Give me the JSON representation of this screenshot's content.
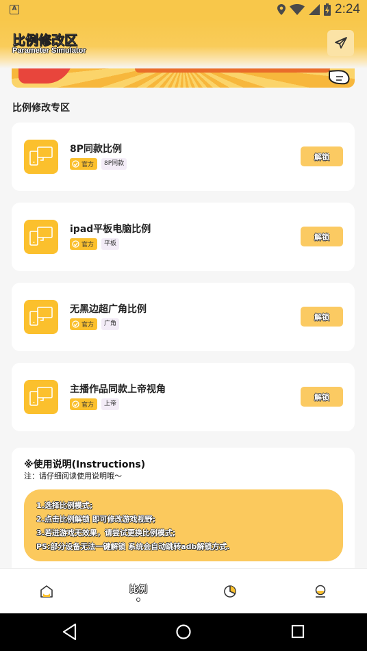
{
  "status_bar": {
    "time": "2:24",
    "app_badge": "A"
  },
  "header": {
    "title": "比例修改区",
    "subtitle": "Parameter Simulator",
    "send_icon": "send-icon"
  },
  "section_title": "比例修改专区",
  "cards": [
    {
      "name": "8P同款比例",
      "tag_official": "官方",
      "tag_category": "8P同款",
      "button": "解锁"
    },
    {
      "name": "ipad平板电脑比例",
      "tag_official": "官方",
      "tag_category": "平板",
      "button": "解锁"
    },
    {
      "name": "无黑边超广角比例",
      "tag_official": "官方",
      "tag_category": "广角",
      "button": "解锁"
    },
    {
      "name": "主播作品同款上帝视角",
      "tag_official": "官方",
      "tag_category": "上帝",
      "button": "解锁"
    }
  ],
  "instructions": {
    "heading": "※使用说明(Instructions)",
    "note": "注：请仔细阅读使用说明哦～",
    "lines": [
      "1.选择比例模式;",
      "2.点击比例解锁 即可修改游戏视野;",
      "3.若进游戏无效果，请尝试更换比例模式;",
      "PS:部分设备无法一键解锁 系统会自动跳转adb解锁方式."
    ]
  },
  "tabbar": {
    "active_label": "比例"
  },
  "colors": {
    "accent": "#fbc02d",
    "header": "#f8c74a",
    "button": "#fbca62",
    "tag": "#f3ecf7"
  }
}
